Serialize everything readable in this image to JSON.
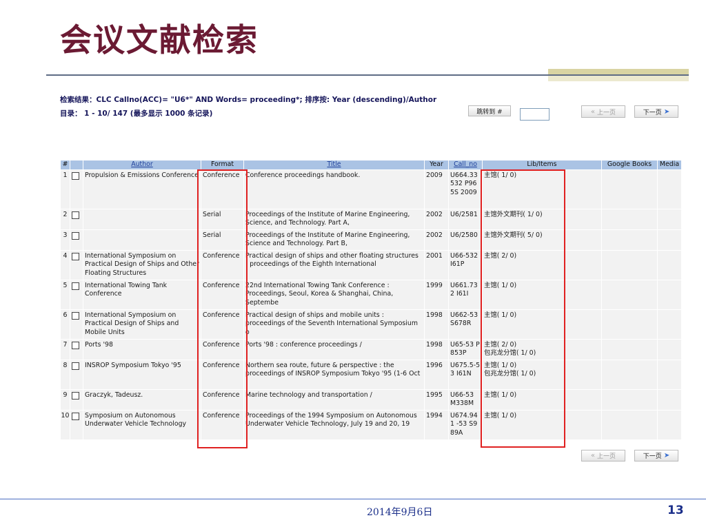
{
  "slide": {
    "title": "会议文献检索",
    "date": "2014年9月6日",
    "page_number": "13"
  },
  "search": {
    "result_line": "检索结果：CLC Callno(ACC)= \"U6*\" AND Words= proceeding*; 排序按: Year (descending)/Author",
    "range_line": "目录： 1 - 10/ 147 (最多显示 1000 条记录)",
    "jump_label": "跳转到 #",
    "jump_value": "",
    "prev_label": "上一页",
    "next_label": "下一页"
  },
  "table": {
    "headers": [
      "#",
      "",
      "Author",
      "Format",
      "Title",
      "Year",
      "Call_no",
      "Lib/Items",
      "Google Books",
      "Media"
    ],
    "rows": [
      {
        "num": "1",
        "author": "Propulsion & Emissions Conference",
        "format": "Conference",
        "title": "Conference proceedings handbook.",
        "year": "2009",
        "call_no": "U664.33 532 P965S 2009",
        "lib": [
          "主馆( 1/ 0)"
        ]
      },
      {
        "num": "2",
        "author": "",
        "format": "Serial",
        "title": "Proceedings of the Institute of Marine Engineering, Science, and Technology. Part A,",
        "year": "2002",
        "call_no": "U6/2581",
        "lib": [
          "主馆外文期刊( 1/ 0)"
        ]
      },
      {
        "num": "3",
        "author": "",
        "format": "Serial",
        "title": "Proceedings of the Institute of Marine Engineering, Science and Technology. Part B,",
        "year": "2002",
        "call_no": "U6/2580",
        "lib": [
          "主馆外文期刊( 5/ 0)"
        ]
      },
      {
        "num": "4",
        "author": "International Symposium on Practical Design of Ships and Other Floating Structures",
        "format": "Conference",
        "title": "Practical design of ships and other floating structures : proceedings of the Eighth International",
        "year": "2001",
        "call_no": "U66-532 I61P",
        "lib": [
          "主馆( 2/ 0)"
        ]
      },
      {
        "num": "5",
        "author": "International Towing Tank Conference",
        "format": "Conference",
        "title": "22nd International Towing Tank Conference : Proceedings, Seoul, Korea & Shanghai, China, Septembe",
        "year": "1999",
        "call_no": "U661.73 2 I61I",
        "lib": [
          "主馆( 1/ 0)"
        ]
      },
      {
        "num": "6",
        "author": "International Symposium on Practical Design of Ships and Mobile Units",
        "format": "Conference",
        "title": "Practical design of ships and mobile units : proceedings of the Seventh International Symposium o",
        "year": "1998",
        "call_no": "U662-53 S678R",
        "lib": [
          "主馆( 1/ 0)"
        ]
      },
      {
        "num": "7",
        "author": "Ports '98",
        "format": "Conference",
        "title": "Ports '98 : conference proceedings /",
        "year": "1998",
        "call_no": "U65-53 P853P",
        "lib": [
          "主馆( 2/ 0)",
          "包兆龙分馆( 1/ 0)"
        ]
      },
      {
        "num": "8",
        "author": "INSROP Symposium Tokyo '95",
        "format": "Conference",
        "title": "Northern sea route, future & perspective : the proceedings of INSROP Symposium Tokyo '95 (1-6 Oct",
        "year": "1996",
        "call_no": "U675.5-53 I61N",
        "lib": [
          "主馆( 1/ 0)",
          "包兆龙分馆( 1/ 0)"
        ]
      },
      {
        "num": "9",
        "author": "Graczyk, Tadeusz.",
        "format": "Conference",
        "title": "Marine technology and transportation /",
        "year": "1995",
        "call_no": "U66-53 M338M",
        "lib": [
          "主馆( 1/ 0)"
        ]
      },
      {
        "num": "10",
        "author": "Symposium on Autonomous Underwater Vehicle Technology",
        "format": "Conference",
        "title": "Proceedings of the 1994 Symposium on Autonomous Underwater Vehicle Technology, July 19 and 20, 19",
        "year": "1994",
        "call_no": "U674.941 -53 S989A",
        "lib": [
          "主馆( 1/ 0)"
        ]
      }
    ]
  },
  "colors": {
    "title": "#6b1a33",
    "header_bg": "#aac3e4",
    "highlight": "#e02020",
    "footer": "#1b2f8a"
  },
  "icons": {
    "prev": "double-chevron-left-icon",
    "next": "arrow-right-icon"
  }
}
